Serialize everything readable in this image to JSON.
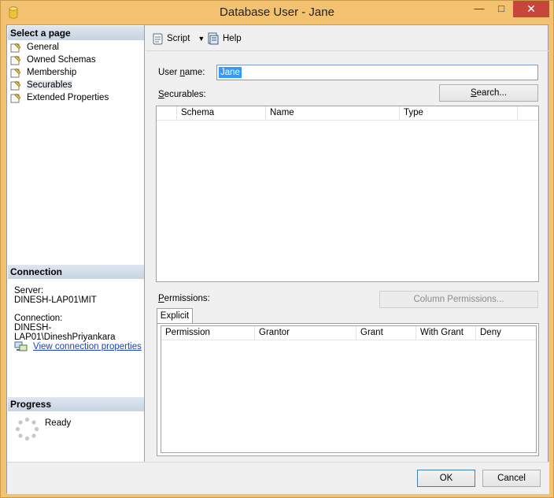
{
  "window": {
    "title": "Database User - Jane",
    "controls": {
      "minimize": "—",
      "maximize": "□",
      "close": "✕"
    }
  },
  "left": {
    "select_page_header": "Select a page",
    "pages": [
      {
        "label": "General"
      },
      {
        "label": "Owned Schemas"
      },
      {
        "label": "Membership"
      },
      {
        "label": "Securables",
        "selected": true
      },
      {
        "label": "Extended Properties"
      }
    ],
    "connection_header": "Connection",
    "server_label": "Server:",
    "server_value": "DINESH-LAP01\\MIT",
    "connection_label": "Connection:",
    "connection_value": "DINESH-LAP01\\DineshPriyankara",
    "view_props_link": "View connection properties",
    "progress_header": "Progress",
    "progress_status": "Ready"
  },
  "toolbar": {
    "script_label": "Script",
    "help_label": "Help"
  },
  "form": {
    "username_label": "User name:",
    "username_value": "Jane",
    "securables_label": "Securables:",
    "search_button": "Search...",
    "securables_columns": [
      "Schema",
      "Name",
      "Type"
    ],
    "permissions_label": "Permissions:",
    "column_permissions_button": "Column Permissions...",
    "tab_explicit": "Explicit",
    "permissions_columns": [
      "Permission",
      "Grantor",
      "Grant",
      "With Grant",
      "Deny"
    ]
  },
  "buttons": {
    "ok": "OK",
    "cancel": "Cancel"
  }
}
